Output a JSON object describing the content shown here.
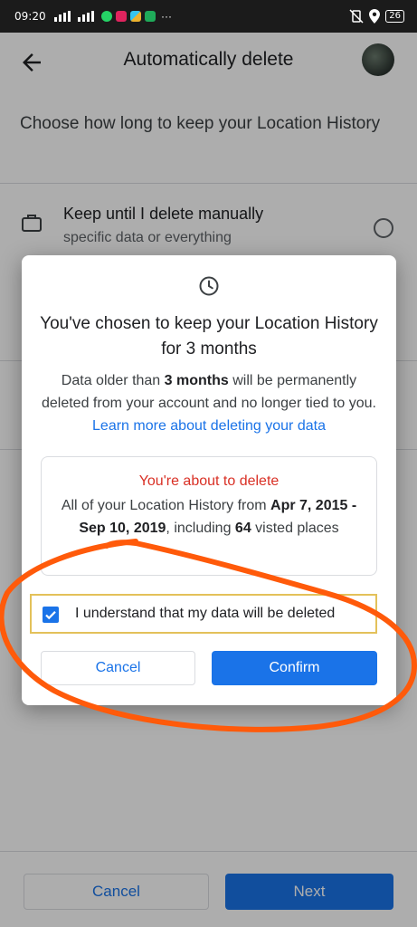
{
  "status_bar": {
    "time": "09:20",
    "more_indicator": "···",
    "battery_level": "26",
    "icons": [
      "signal-bars-icon",
      "signal-bars-icon",
      "whatsapp-icon",
      "app-icon",
      "slack-icon",
      "chat-icon",
      "mute-vibrate-icon",
      "location-icon",
      "battery-icon"
    ]
  },
  "header": {
    "title": "Automatically delete",
    "back_icon": "arrow-left-icon"
  },
  "page": {
    "intro": "Choose how long to keep your Location History",
    "option": {
      "title": "Keep until I delete manually",
      "subtitle": "specific data or everything",
      "icon": "briefcase-icon"
    }
  },
  "bottom_bar": {
    "cancel_label": "Cancel",
    "next_label": "Next"
  },
  "dialog": {
    "icon": "clock-icon",
    "title": "You've chosen to keep your Location History for 3 months",
    "body_prefix": "Data older than ",
    "body_bold": "3 months",
    "body_middle": " will be permanently deleted from your account and no longer tied to you. ",
    "body_link": "Learn more about deleting your data",
    "warning": {
      "title": "You're about to delete",
      "text_prefix": "All of your Location History from ",
      "date_range": "Apr 7, 2015 - Sep 10, 2019",
      "text_middle": ", including ",
      "count": "64",
      "text_suffix": " visted places"
    },
    "acknowledge_label": "I understand that my data will be deleted",
    "acknowledge_checked": true,
    "cancel_label": "Cancel",
    "confirm_label": "Confirm"
  },
  "colors": {
    "accent": "#1a73e8",
    "warning_red": "#d93025",
    "annotation_orange": "#ff5a0a",
    "highlight_border": "#e3c15a"
  }
}
